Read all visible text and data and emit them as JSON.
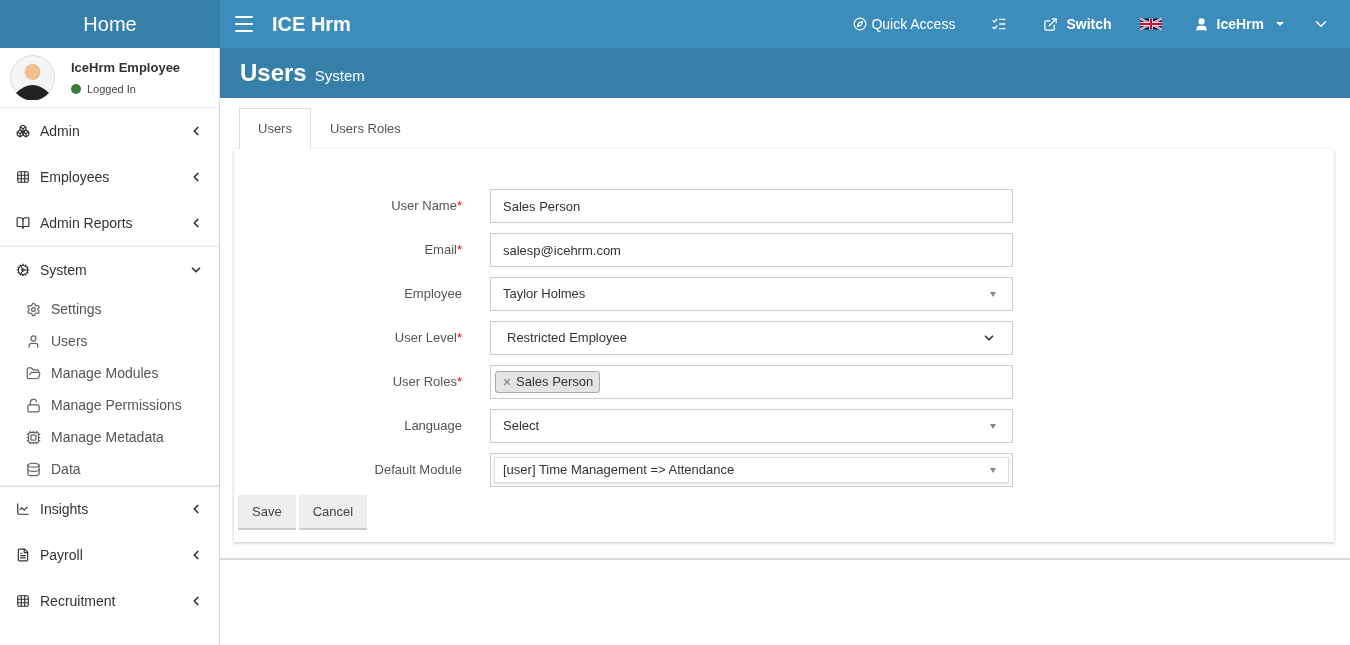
{
  "brand": "Home",
  "app_title": "ICE Hrm",
  "top_nav": {
    "quick_access": "Quick Access",
    "switch": "Switch",
    "user": "IceHrm"
  },
  "profile": {
    "name": "IceHrm Employee",
    "status": "Logged In",
    "online": true
  },
  "sidebar": {
    "items": [
      {
        "label": "Admin",
        "expanded": false
      },
      {
        "label": "Employees",
        "expanded": false
      },
      {
        "label": "Admin Reports",
        "expanded": false
      },
      {
        "label": "System",
        "expanded": true,
        "children": [
          {
            "label": "Settings"
          },
          {
            "label": "Users"
          },
          {
            "label": "Manage Modules"
          },
          {
            "label": "Manage Permissions"
          },
          {
            "label": "Manage Metadata"
          },
          {
            "label": "Data"
          }
        ]
      },
      {
        "label": "Insights",
        "expanded": false
      },
      {
        "label": "Payroll",
        "expanded": false
      },
      {
        "label": "Recruitment",
        "expanded": false
      }
    ]
  },
  "page_header": {
    "title": "Users",
    "subtitle": "System"
  },
  "tabs": [
    {
      "label": "Users",
      "selected": true
    },
    {
      "label": "Users Roles",
      "selected": false
    }
  ],
  "form": {
    "fields": [
      {
        "kind": "text",
        "label": "User Name",
        "required_mark": "*",
        "value": "Sales Person"
      },
      {
        "kind": "text",
        "label": "Email",
        "required_mark": "*",
        "value": "salesp@icehrm.com"
      },
      {
        "kind": "select",
        "label": "Employee",
        "value": "Taylor Holmes"
      },
      {
        "kind": "native",
        "label": "User Level",
        "required_mark": "*",
        "value": "Restricted Employee"
      },
      {
        "kind": "tags",
        "label": "User Roles",
        "required_mark": "*",
        "tags": [
          "Sales Person"
        ]
      },
      {
        "kind": "select",
        "label": "Language",
        "value": "Select"
      },
      {
        "kind": "select",
        "label": "Default Module",
        "value": "[user] Time Management => Attendance",
        "focused": true
      }
    ],
    "buttons": [
      "Save",
      "Cancel"
    ]
  }
}
